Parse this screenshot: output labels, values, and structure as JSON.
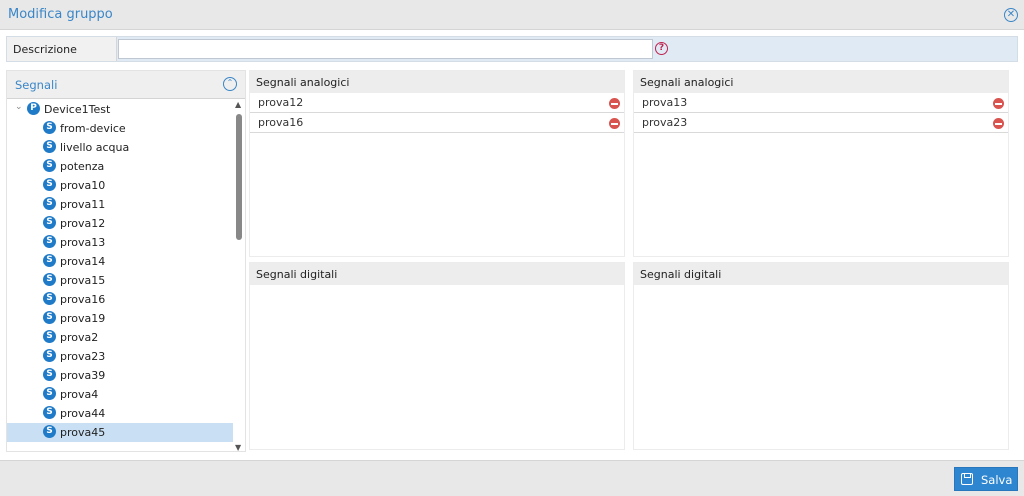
{
  "dialog": {
    "title": "Modifica gruppo"
  },
  "description": {
    "label": "Descrizione",
    "value": "",
    "placeholder": ""
  },
  "tree": {
    "header": "Segnali",
    "root": "Device1Test",
    "root_icon": "P",
    "signal_icon": "S",
    "items": [
      "from-device",
      "livello acqua",
      "potenza",
      "prova10",
      "prova11",
      "prova12",
      "prova13",
      "prova14",
      "prova15",
      "prova16",
      "prova19",
      "prova2",
      "prova23",
      "prova39",
      "prova4",
      "prova44",
      "prova45"
    ],
    "selected": "prova45"
  },
  "panels": {
    "left_analog": {
      "title": "Segnali analogici",
      "rows": [
        "prova12",
        "prova16"
      ]
    },
    "right_analog": {
      "title": "Segnali analogici",
      "rows": [
        "prova13",
        "prova23"
      ]
    },
    "left_digital": {
      "title": "Segnali digitali",
      "rows": []
    },
    "right_digital": {
      "title": "Segnali digitali",
      "rows": []
    }
  },
  "footer": {
    "save_label": "Salva"
  },
  "colors": {
    "accent": "#3a86c8",
    "selected_row": "#c9dff3",
    "remove": "#d9534f",
    "save_button": "#2f86d0"
  }
}
